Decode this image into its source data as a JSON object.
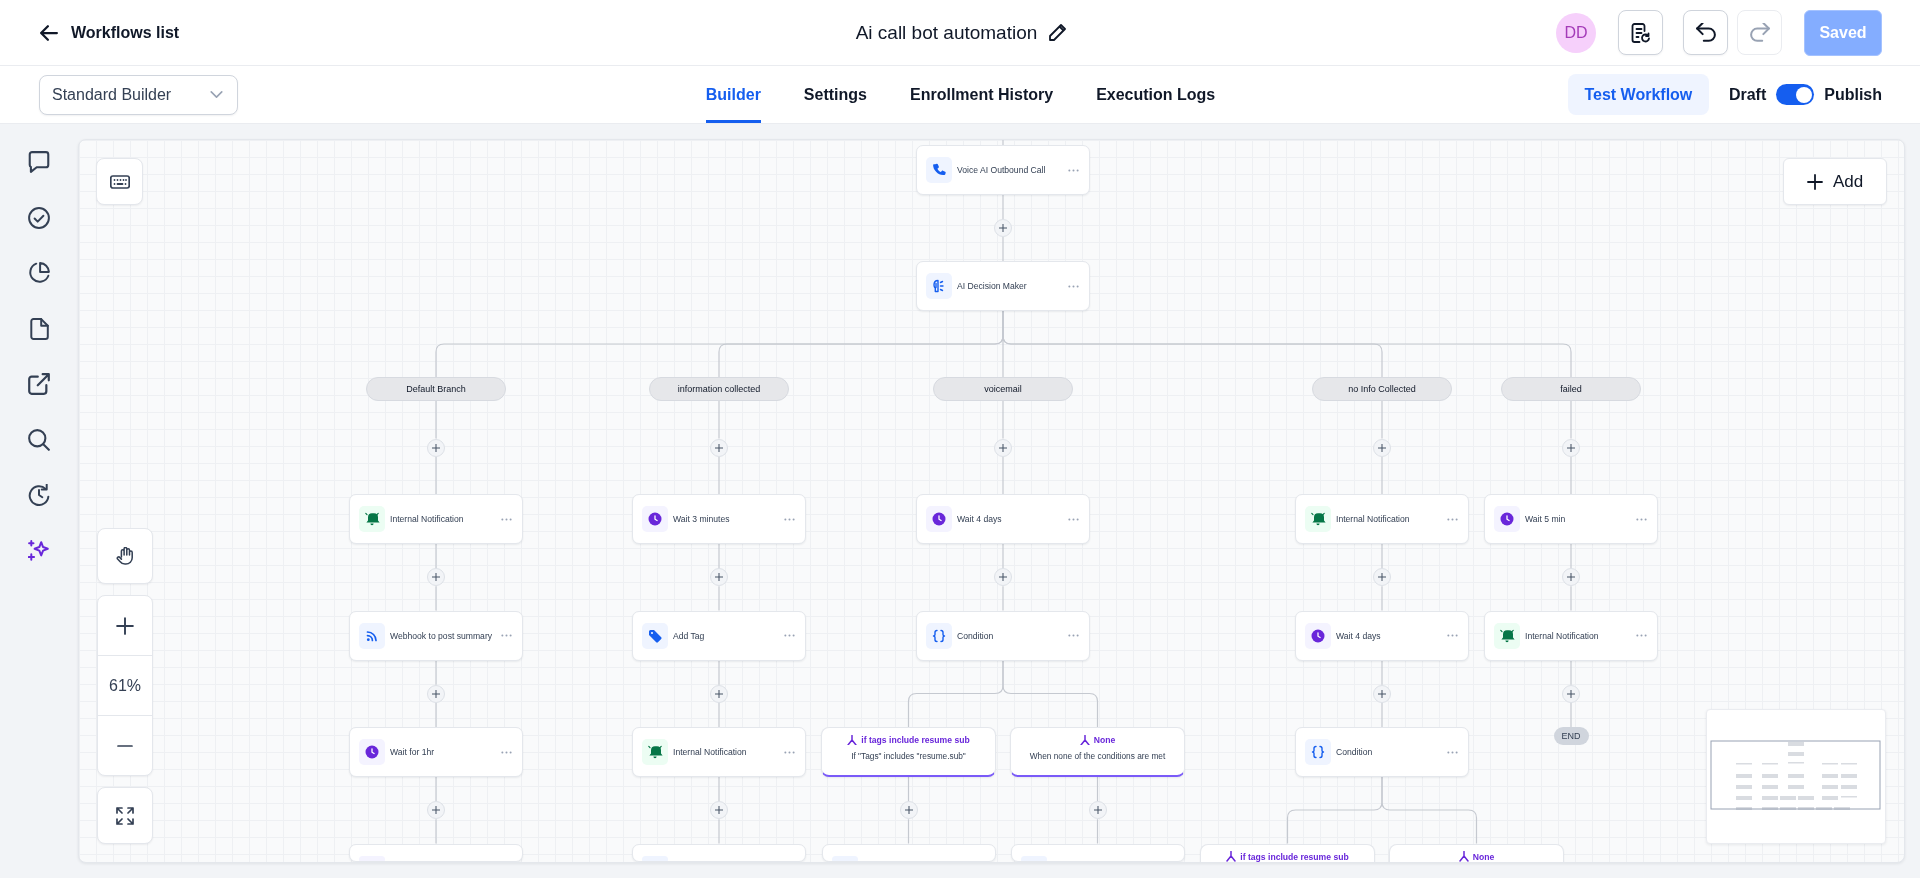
{
  "header": {
    "back_label": "Workflows list",
    "title": "Ai call bot automation",
    "avatar": "DD",
    "history": [
      {
        "kind": "undo",
        "disabled": false
      },
      {
        "kind": "redo",
        "disabled": true
      }
    ],
    "save": {
      "label": "Saved",
      "disabled": true
    }
  },
  "toolbar": {
    "builder": "Standard Builder",
    "tabs": [
      {
        "label": "Builder",
        "selected": true
      },
      {
        "label": "Settings",
        "selected": false
      },
      {
        "label": "Enrollment History",
        "selected": false
      },
      {
        "label": "Execution Logs",
        "selected": false
      }
    ],
    "test_label": "Test Workflow",
    "draft_label": "Draft",
    "publish_label": "Publish",
    "publish_on": true
  },
  "canvas": {
    "zoom_label": "61%",
    "add_label": "Add",
    "trigger_steps": [
      {
        "kind": "call",
        "label": "Voice AI Outbound Call"
      },
      {
        "kind": "ai",
        "label": "AI Decision Maker"
      }
    ],
    "branches": [
      {
        "label": "Default Branch",
        "steps": [
          {
            "kind": "notification",
            "label": "Internal Notification"
          },
          {
            "kind": "webhook",
            "label": "Webhook to post summary"
          },
          {
            "kind": "wait",
            "label": "Wait for 1hr"
          },
          {
            "kind": "wait"
          }
        ]
      },
      {
        "label": "information collected",
        "steps": [
          {
            "kind": "wait",
            "label": "Wait 3 minutes"
          },
          {
            "kind": "tag",
            "label": "Add Tag"
          },
          {
            "kind": "notification",
            "label": "Internal Notification"
          },
          {
            "kind": "webhook"
          }
        ]
      },
      {
        "label": "voicemail",
        "steps": [
          {
            "kind": "wait",
            "label": "Wait 4 days"
          },
          {
            "kind": "condition",
            "label": "Condition",
            "branches": [
              {
                "title": "if tags include resume sub",
                "rule": "If \"Tags\" includes \"resume.sub\"",
                "continues": true
              },
              {
                "title": "None",
                "rule": "When none of the conditions are met",
                "continues": true
              }
            ]
          }
        ]
      },
      {
        "label": "no Info Collected",
        "steps": [
          {
            "kind": "notification",
            "label": "Internal Notification"
          },
          {
            "kind": "wait",
            "label": "Wait 4 days"
          },
          {
            "kind": "condition",
            "label": "Condition",
            "branches": [
              {
                "title": "if tags include resume sub"
              },
              {
                "title": "None"
              }
            ]
          }
        ]
      },
      {
        "label": "failed",
        "steps": [
          {
            "kind": "wait",
            "label": "Wait 5 min"
          },
          {
            "kind": "notification",
            "label": "Internal Notification"
          },
          {
            "kind": "end",
            "label": "END"
          }
        ]
      }
    ]
  }
}
